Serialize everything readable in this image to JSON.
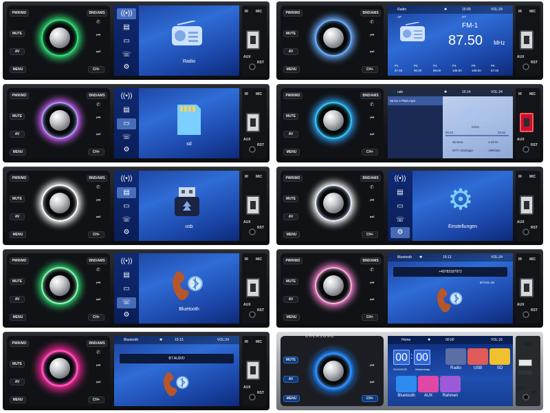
{
  "hardware": {
    "pwr_mo": "PWR/MO",
    "band_ams": "BND/AMS",
    "mute": "MUTE",
    "av": "AV",
    "menu": "MENU",
    "ch_plus": "CH+",
    "mic": "MIC",
    "ir": "IR",
    "aux": "AUX",
    "rst": "RST",
    "brand": "CREASONO"
  },
  "glow_colors": [
    "#35e07a",
    "#6fb0ff",
    "#d36bff",
    "#38e4ff",
    "#ffffff",
    "#ff5ad0",
    "#5aa8ff"
  ],
  "panels": {
    "radio_menu": {
      "caption": "Radio",
      "icon": "radio-icon"
    },
    "radio_player": {
      "source": "Radio",
      "time": "15:09",
      "volume": "VOL:24",
      "band": "FM-1",
      "frequency": "87.50",
      "unit": "MHz",
      "sub_left": "AP",
      "sub_right": "ST",
      "presets": [
        {
          "label": "P1",
          "freq": "87.50"
        },
        {
          "label": "P2",
          "freq": "90.00"
        },
        {
          "label": "P3",
          "freq": "98.00"
        },
        {
          "label": "P4",
          "freq": "106.00"
        },
        {
          "label": "P5",
          "freq": "108.00"
        },
        {
          "label": "P6",
          "freq": "87.50"
        }
      ]
    },
    "sd_menu": {
      "caption": "sd",
      "icon": "sd-card-icon"
    },
    "usb_player": {
      "source": "usb",
      "time": "15:14",
      "volume": "VOL:24",
      "track": "08 Do A Plain.mp3",
      "elapsed": "00:24",
      "total": "03:44",
      "index": "01/01",
      "artist": "Nirvana",
      "size": "4.29 M",
      "album": "MTV Unplugge",
      "bitrate": "198Kbps"
    },
    "usb_menu": {
      "caption": "usb",
      "icon": "usb-stick-icon"
    },
    "settings_menu": {
      "caption": "Einstellungen",
      "icon": "gear-icon"
    },
    "bluetooth_menu": {
      "caption": "Bluetooth",
      "icon": "bluetooth-phone-icon"
    },
    "bluetooth_call": {
      "source": "Bluetooth",
      "time": "15:12",
      "volume": "VOL:24",
      "number": "+49783187972",
      "device": "BTVOL:26"
    },
    "bluetooth_audio": {
      "source": "Bluetooth",
      "time": "15:13",
      "volume": "VOL:24",
      "label": "BT AUDIO"
    },
    "home": {
      "title": "Home",
      "time": "00:00",
      "volume": "VOL:16",
      "clock": [
        "00",
        "00"
      ],
      "date": "01/01/2022",
      "weekday": "Wednesday",
      "tiles": [
        {
          "label": "Radio",
          "color": "#5b6ea6"
        },
        {
          "label": "USB",
          "color": "#e05a5a"
        },
        {
          "label": "SD",
          "color": "#f0c030"
        },
        {
          "label": "Bluetooth",
          "color": "#2d8cf0"
        },
        {
          "label": "AUX",
          "color": "#e048a8"
        },
        {
          "label": "Rahmen",
          "color": "#9c5ad8"
        }
      ]
    }
  }
}
